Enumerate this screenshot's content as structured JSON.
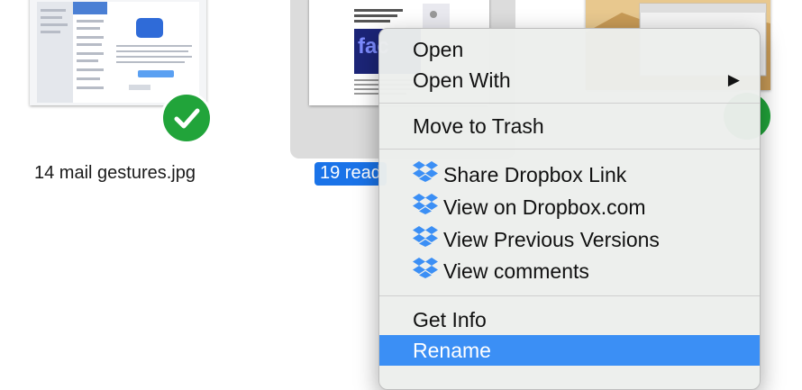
{
  "files": [
    {
      "label": "14 mail gestures.jpg",
      "synced": true
    },
    {
      "label": "19 read",
      "selected": true
    },
    {
      "label": "",
      "synced": true
    }
  ],
  "thumbnail_text": {
    "read_logo": "fac",
    "read_headline": "Facebook and the big story"
  },
  "context_menu": {
    "items": {
      "open": "Open",
      "open_with": "Open With",
      "move_to_trash": "Move to Trash",
      "share_dropbox_link": "Share Dropbox Link",
      "view_on_dropbox": "View on Dropbox.com",
      "view_previous_versions": "View Previous Versions",
      "view_comments": "View comments",
      "get_info": "Get Info",
      "rename": "Rename"
    },
    "highlighted": "rename",
    "submenu_arrow": "▶",
    "dropbox_icon": "dropbox-icon"
  },
  "colors": {
    "selection_blue": "#3b8ff5",
    "label_selection": "#1a73e8",
    "sync_green": "#21a43a",
    "menu_bg": "#eceeec"
  }
}
